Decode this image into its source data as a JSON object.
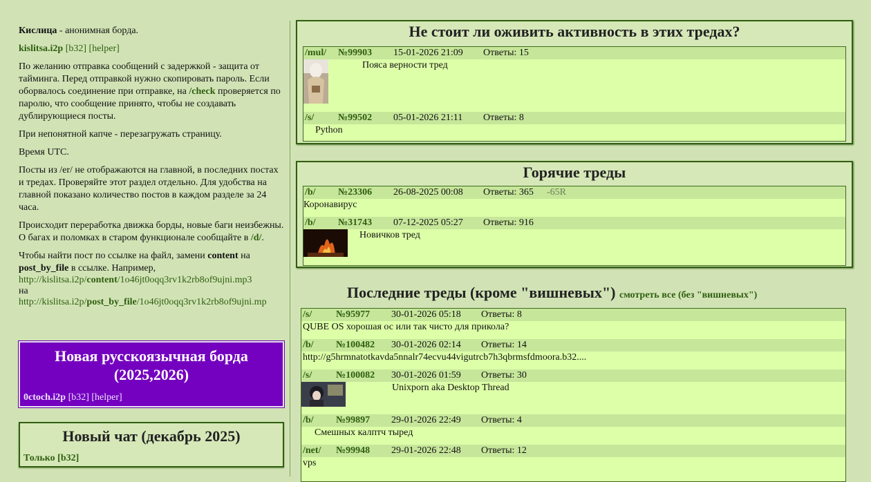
{
  "left": {
    "intro_name": "Кислица",
    "intro_rest": " - анонимная борда.",
    "site_link": "kislitsa.i2p",
    "site_b32": "[b32]",
    "site_helper": "[helper]",
    "p_delay_1": "По желанию отправка сообщений с задержкой - защита от тайминга. Перед отправкой нужно скопировать пароль. Если оборвалось соединение при отправке, на ",
    "p_delay_check": "/check",
    "p_delay_2": " проверяется по паролю, что сообщение принято, чтобы не создавать дублирующиеся посты.",
    "p_captcha": "При непонятной капче - перезагружать страницу.",
    "p_time": "Время UTC.",
    "p_er": "Посты из /er/ не отображаются на главной, в последних постах и тредах. Проверяйте этот раздел отдельно. Для удобства на главной показано количество постов в каждом разделе за 24 часа.",
    "p_rework_1": "Происходит переработка движка борды, новые баги неизбежны. О багах и поломках в старом функционале сообщайте в ",
    "p_rework_d": "/d/",
    "p_rework_2": ".",
    "p_find_1": "Чтобы найти пост по ссылке на файл, замени ",
    "p_find_content": "content",
    "p_find_2": " на ",
    "p_find_pbf": "post_by_file",
    "p_find_3": " в ссылке. Например,",
    "url1_pre": "http://kislitsa.i2p/",
    "url1_mid": "content",
    "url1_post": "/1o46jt0oqq3rv1k2rb8of9ujni.mp3",
    "url_on": "на",
    "url2_pre": "http://kislitsa.i2p/",
    "url2_mid": "post_by_file",
    "url2_post": "/1o46jt0oqq3rv1k2rb8of9ujni.mp"
  },
  "promo": {
    "title_1": "Новая русскоязычная борда",
    "title_2": "(2025,2026)",
    "link": "0ctoch.i2p",
    "b32": "[b32]",
    "helper": "[helper]"
  },
  "chat": {
    "title": "Новый чат (декабрь 2025)",
    "link": "Только [b32]"
  },
  "revive": {
    "title": "Не стоит ли оживить активность в этих тредах?",
    "threads": [
      {
        "board": "/mul/",
        "num": "№99903",
        "date": "15-01-2026 21:09",
        "replies": "Ответы: 15",
        "subject": "Пояса верности тред"
      },
      {
        "board": "/s/",
        "num": "№99502",
        "date": "05-01-2026 21:11",
        "replies": "Ответы: 8",
        "subject": "Python"
      }
    ]
  },
  "hot": {
    "title": "Горячие треды",
    "threads": [
      {
        "board": "/b/",
        "num": "№23306",
        "date": "26-08-2025 00:08",
        "replies": "Ответы: 365",
        "rep": "-65R",
        "subject": "Коронавирус"
      },
      {
        "board": "/b/",
        "num": "№31743",
        "date": "07-12-2025 05:27",
        "replies": "Ответы: 916",
        "subject": "Новичков тред"
      }
    ]
  },
  "latest": {
    "title": "Последние треды (кроме \"вишневых\")",
    "view_all": "смотреть все (без \"вишневых\")",
    "threads": [
      {
        "board": "/s/",
        "num": "№95977",
        "date": "30-01-2026 05:18",
        "replies": "Ответы: 8",
        "subject": "QUBE OS хорошая ос или так чисто для прикола?"
      },
      {
        "board": "/b/",
        "num": "№100482",
        "date": "30-01-2026 02:14",
        "replies": "Ответы: 14",
        "subject": "http://g5hrmnatotkavda5nnalr74ecvu44vigutrcb7h3qbrmsfdmoora.b32...."
      },
      {
        "board": "/s/",
        "num": "№100082",
        "date": "30-01-2026 01:59",
        "replies": "Ответы: 30",
        "subject": "Unixporn aka Desktop Thread"
      },
      {
        "board": "/b/",
        "num": "№99897",
        "date": "29-01-2026 22:49",
        "replies": "Ответы: 4",
        "subject": "Смешных калптч тыред"
      },
      {
        "board": "/net/",
        "num": "№99948",
        "date": "29-01-2026 22:48",
        "replies": "Ответы: 12",
        "subject": "vps"
      }
    ]
  }
}
